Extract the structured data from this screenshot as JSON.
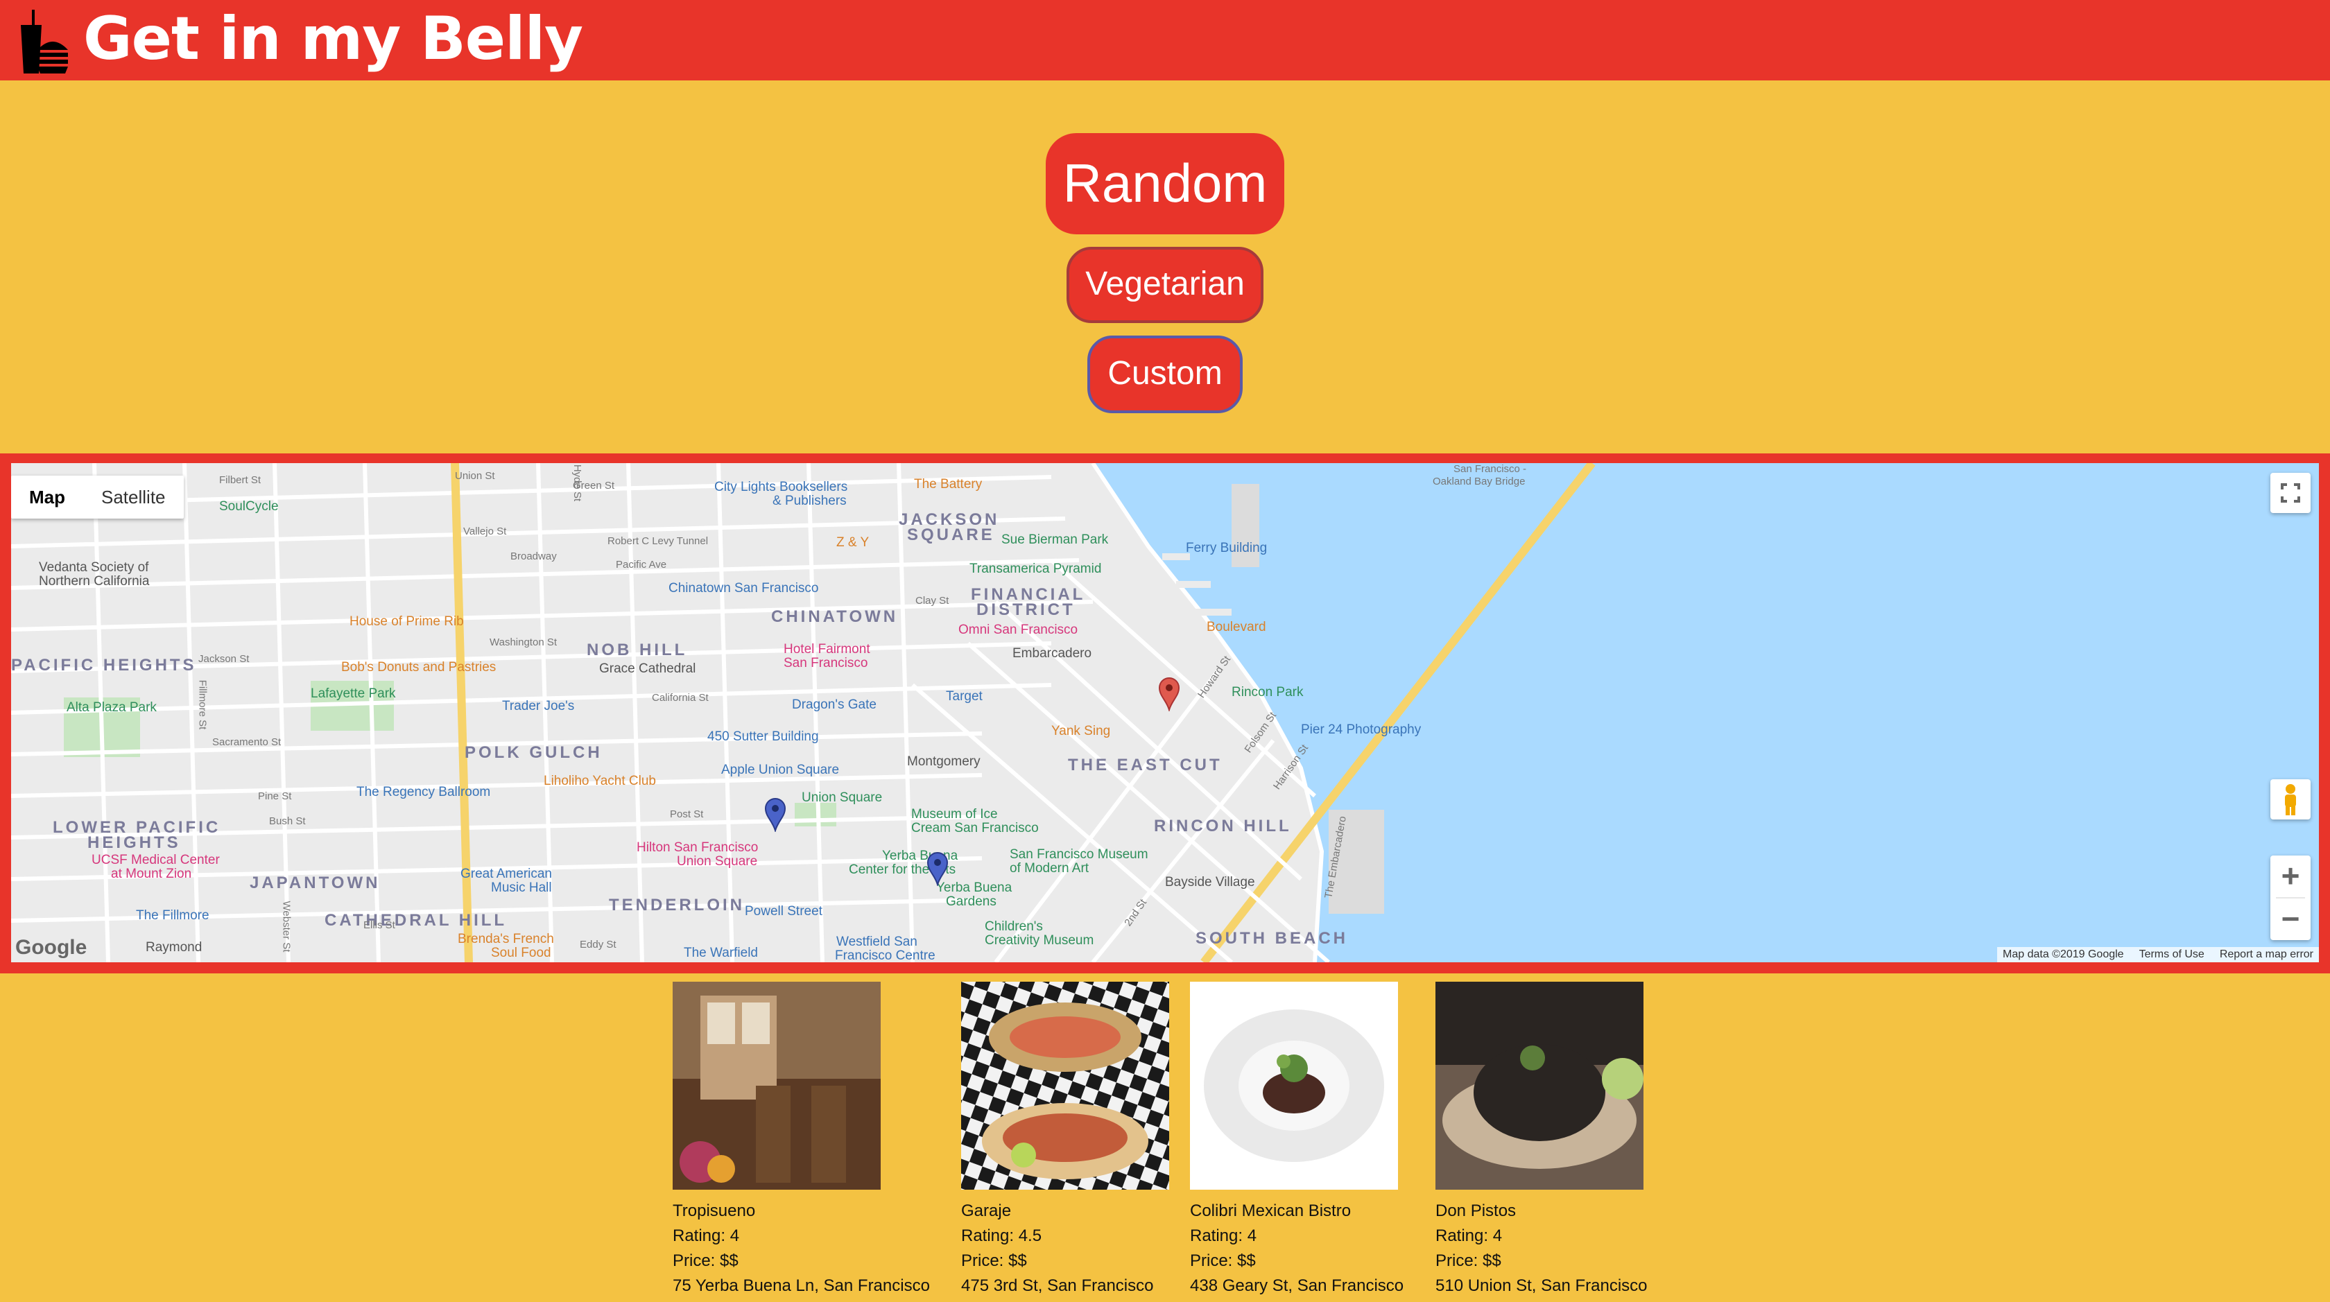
{
  "header": {
    "title": "Get in my Belly",
    "logo_icon": "fast-food-icon",
    "background": "#e8342a"
  },
  "actions": {
    "random_label": "Random",
    "vegetarian_label": "Vegetarian",
    "custom_label": "Custom"
  },
  "map": {
    "type_map_label": "Map",
    "type_satellite_label": "Satellite",
    "active_type": "Map",
    "fullscreen_icon": "fullscreen-icon",
    "pegman_icon": "street-view-pegman-icon",
    "zoom_in_label": "+",
    "zoom_out_label": "−",
    "google_logo": "Google",
    "footer_data": "Map data ©2019 Google",
    "footer_terms": "Terms of Use",
    "footer_report": "Report a map error",
    "labels": [
      {
        "text": "JACKSON",
        "cls": "lbl-dist"
      },
      {
        "text": "SQUARE",
        "cls": "lbl-dist"
      },
      {
        "text": "FINANCIAL",
        "cls": "lbl-dist"
      },
      {
        "text": "DISTRICT",
        "cls": "lbl-dist"
      },
      {
        "text": "CHINATOWN",
        "cls": "lbl-dist"
      },
      {
        "text": "NOB HILL",
        "cls": "lbl-dist"
      },
      {
        "text": "PACIFIC HEIGHTS",
        "cls": "lbl-dist"
      },
      {
        "text": "POLK GULCH",
        "cls": "lbl-dist"
      },
      {
        "text": "THE EAST CUT",
        "cls": "lbl-dist"
      },
      {
        "text": "RINCON HILL",
        "cls": "lbl-dist"
      },
      {
        "text": "LOWER PACIFIC",
        "cls": "lbl-dist"
      },
      {
        "text": "HEIGHTS",
        "cls": "lbl-dist"
      },
      {
        "text": "JAPANTOWN",
        "cls": "lbl-dist"
      },
      {
        "text": "TENDERLOIN",
        "cls": "lbl-dist"
      },
      {
        "text": "CATHEDRAL HILL",
        "cls": "lbl-dist"
      },
      {
        "text": "SOUTH BEACH",
        "cls": "lbl-dist"
      },
      {
        "text": "City Lights Booksellers",
        "cls": "lbl-poi-blue"
      },
      {
        "text": "& Publishers",
        "cls": "lbl-poi-blue"
      },
      {
        "text": "The Battery",
        "cls": "lbl-poi-orange"
      },
      {
        "text": "SoulCycle",
        "cls": "lbl-poi-green"
      },
      {
        "text": "Sue Bierman Park",
        "cls": "lbl-poi-green"
      },
      {
        "text": "Z & Y",
        "cls": "lbl-poi-orange"
      },
      {
        "text": "Ferry Building",
        "cls": "lbl-poi-blue"
      },
      {
        "text": "Transamerica Pyramid",
        "cls": "lbl-poi-green"
      },
      {
        "text": "Vedanta Society of",
        "cls": "lbl-dark"
      },
      {
        "text": "Northern California",
        "cls": "lbl-dark"
      },
      {
        "text": "Chinatown San Francisco",
        "cls": "lbl-poi-blue"
      },
      {
        "text": "Boulevard",
        "cls": "lbl-poi-orange"
      },
      {
        "text": "House of Prime Rib",
        "cls": "lbl-poi-orange"
      },
      {
        "text": "Hotel Fairmont",
        "cls": "lbl-poi-pink"
      },
      {
        "text": "San Francisco",
        "cls": "lbl-poi-pink"
      },
      {
        "text": "Omni San Francisco",
        "cls": "lbl-poi-pink"
      },
      {
        "text": "Embarcadero",
        "cls": "lbl-dark"
      },
      {
        "text": "Grace Cathedral",
        "cls": "lbl-dark"
      },
      {
        "text": "Bob's Donuts and Pastries",
        "cls": "lbl-poi-orange"
      },
      {
        "text": "Lafayette Park",
        "cls": "lbl-poi-green"
      },
      {
        "text": "Alta Plaza Park",
        "cls": "lbl-poi-green"
      },
      {
        "text": "Trader Joe's",
        "cls": "lbl-poi-blue"
      },
      {
        "text": "Dragon's Gate",
        "cls": "lbl-poi-blue"
      },
      {
        "text": "Target",
        "cls": "lbl-poi-blue"
      },
      {
        "text": "Rincon Park",
        "cls": "lbl-poi-green"
      },
      {
        "text": "Yank Sing",
        "cls": "lbl-poi-orange"
      },
      {
        "text": "Pier 24 Photography",
        "cls": "lbl-poi-blue"
      },
      {
        "text": "450 Sutter Building",
        "cls": "lbl-poi-blue"
      },
      {
        "text": "Liholiho Yacht Club",
        "cls": "lbl-poi-orange"
      },
      {
        "text": "Apple Union Square",
        "cls": "lbl-poi-blue"
      },
      {
        "text": "Montgomery",
        "cls": "lbl-dark"
      },
      {
        "text": "The Regency Ballroom",
        "cls": "lbl-poi-blue"
      },
      {
        "text": "Union Square",
        "cls": "lbl-poi-green"
      },
      {
        "text": "Museum of Ice",
        "cls": "lbl-poi-green"
      },
      {
        "text": "Cream San Francisco",
        "cls": "lbl-poi-green"
      },
      {
        "text": "Hilton San Francisco",
        "cls": "lbl-poi-pink"
      },
      {
        "text": "Union Square",
        "cls": "lbl-poi-pink"
      },
      {
        "text": "UCSF Medical Center",
        "cls": "lbl-poi-pink"
      },
      {
        "text": "at Mount Zion",
        "cls": "lbl-poi-pink"
      },
      {
        "text": "Yerba Buena",
        "cls": "lbl-poi-green"
      },
      {
        "text": "Center for the Arts",
        "cls": "lbl-poi-green"
      },
      {
        "text": "San Francisco Museum",
        "cls": "lbl-poi-green"
      },
      {
        "text": "of Modern Art",
        "cls": "lbl-poi-green"
      },
      {
        "text": "Yerba Buena",
        "cls": "lbl-poi-green"
      },
      {
        "text": "Gardens",
        "cls": "lbl-poi-green"
      },
      {
        "text": "Bayside Village",
        "cls": "lbl-dark"
      },
      {
        "text": "Great American",
        "cls": "lbl-poi-blue"
      },
      {
        "text": "Music Hall",
        "cls": "lbl-poi-blue"
      },
      {
        "text": "The Fillmore",
        "cls": "lbl-poi-blue"
      },
      {
        "text": "Powell Street",
        "cls": "lbl-poi-blue"
      },
      {
        "text": "Children's",
        "cls": "lbl-poi-green"
      },
      {
        "text": "Creativity Museum",
        "cls": "lbl-poi-green"
      },
      {
        "text": "Raymond",
        "cls": "lbl-dark"
      },
      {
        "text": "Brenda's French",
        "cls": "lbl-poi-orange"
      },
      {
        "text": "Soul Food",
        "cls": "lbl-poi-orange"
      },
      {
        "text": "The Warfield",
        "cls": "lbl-poi-blue"
      },
      {
        "text": "Westfield San",
        "cls": "lbl-poi-blue"
      },
      {
        "text": "Francisco Centre",
        "cls": "lbl-poi-blue"
      },
      {
        "text": "San Francisco -",
        "cls": "lbl-street"
      },
      {
        "text": "Oakland Bay Bridge",
        "cls": "lbl-street"
      },
      {
        "text": "Broadway",
        "cls": "lbl-street"
      },
      {
        "text": "Robert C Levy Tunnel",
        "cls": "lbl-street"
      },
      {
        "text": "California St",
        "cls": "lbl-street"
      },
      {
        "text": "Pine St",
        "cls": "lbl-street"
      },
      {
        "text": "Bush St",
        "cls": "lbl-street"
      },
      {
        "text": "Post St",
        "cls": "lbl-street"
      },
      {
        "text": "Jackson St",
        "cls": "lbl-street"
      },
      {
        "text": "Washington St",
        "cls": "lbl-street"
      },
      {
        "text": "Sacramento St",
        "cls": "lbl-street"
      },
      {
        "text": "Clay St",
        "cls": "lbl-street"
      },
      {
        "text": "Howard St",
        "cls": "lbl-street"
      },
      {
        "text": "Folsom St",
        "cls": "lbl-street"
      },
      {
        "text": "Harrison St",
        "cls": "lbl-street"
      },
      {
        "text": "The Embarcadero",
        "cls": "lbl-street"
      },
      {
        "text": "2nd St",
        "cls": "lbl-street"
      },
      {
        "text": "Ellis St",
        "cls": "lbl-street"
      },
      {
        "text": "Eddy St",
        "cls": "lbl-street"
      },
      {
        "text": "Fillmore St",
        "cls": "lbl-street"
      },
      {
        "text": "Union St",
        "cls": "lbl-street"
      },
      {
        "text": "Green St",
        "cls": "lbl-street"
      },
      {
        "text": "Vallejo St",
        "cls": "lbl-street"
      },
      {
        "text": "Pacific Ave",
        "cls": "lbl-street"
      },
      {
        "text": "Hyde St",
        "cls": "lbl-street"
      },
      {
        "text": "Filbert St",
        "cls": "lbl-street"
      },
      {
        "text": "Webster St",
        "cls": "lbl-street"
      }
    ],
    "markers": [
      {
        "color": "#e05a4e",
        "type": "red-marker-icon"
      },
      {
        "color": "#4a63c9",
        "type": "blue-marker-icon"
      },
      {
        "color": "#4a63c9",
        "type": "blue-marker-icon"
      }
    ]
  },
  "restaurants": [
    {
      "name": "Tropisueno",
      "rating": "Rating: 4",
      "price": "Price: $$",
      "address": "75 Yerba Buena Ln, San Francisco",
      "photo_colors": [
        "#5b3a24",
        "#8a6a4b",
        "#c2a07b"
      ]
    },
    {
      "name": "Garaje",
      "rating": "Rating: 4.5",
      "price": "Price: $$",
      "address": "475 3rd St, San Francisco",
      "photo_colors": [
        "#1a1a1a",
        "#f2f2f2",
        "#c9a46a"
      ]
    },
    {
      "name": "Colibri Mexican Bistro",
      "rating": "Rating: 4",
      "price": "Price: $$",
      "address": "438 Geary St, San Francisco",
      "photo_colors": [
        "#ffffff",
        "#e9e9e9",
        "#4a2a22"
      ]
    },
    {
      "name": "Don Pistos",
      "rating": "Rating: 4",
      "price": "Price: $$",
      "address": "510 Union St, San Francisco",
      "photo_colors": [
        "#2a2522",
        "#6b5a4d",
        "#c8b49a"
      ]
    }
  ]
}
